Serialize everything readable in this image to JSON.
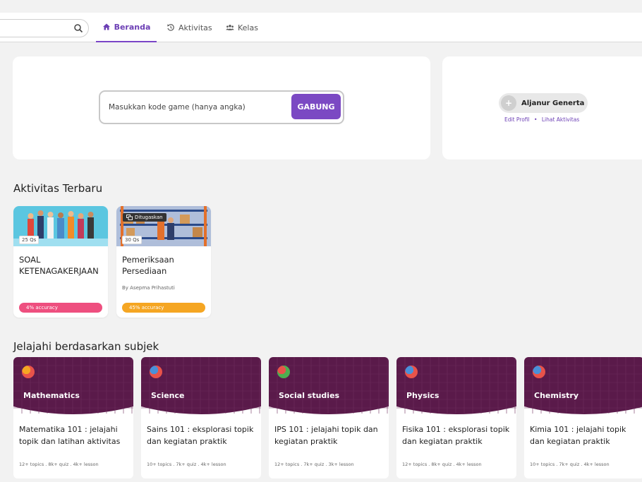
{
  "nav": {
    "tabs": [
      {
        "label": "Beranda",
        "icon": "home-icon"
      },
      {
        "label": "Aktivitas",
        "icon": "history-icon"
      },
      {
        "label": "Kelas",
        "icon": "users-icon"
      }
    ],
    "active_color": "#6c3fb5"
  },
  "join": {
    "placeholder": "Masukkan kode game (hanya angka)",
    "button_label": "GABUNG"
  },
  "profile": {
    "name": "Aljanur Generta",
    "edit_link": "Edit Profil",
    "separator": "•",
    "activity_link": "Lihat Aktivitas"
  },
  "recent": {
    "title": "Aktivitas Terbaru",
    "cards": [
      {
        "title": "SOAL KETENAGAKERJAAN",
        "questions": "25 Qs",
        "accuracy": "4% accuracy",
        "accuracy_color": "#ee4f7f",
        "tag": "",
        "author": ""
      },
      {
        "title": "Pemeriksaan Persediaan",
        "questions": "30 Qs",
        "accuracy": "45% accuracy",
        "accuracy_color": "#f5a623",
        "tag": "Ditugaskan",
        "author": "By Asepma Prihastuti"
      }
    ]
  },
  "explore": {
    "title": "Jelajahi berdasarkan subjek",
    "header_color": "#5a1a4a",
    "subjects": [
      {
        "name": "Mathematics",
        "desc": "Matematika 101 : jelajahi topik dan latihan aktivitas",
        "meta": "12+ topics . 8k+ quiz . 4k+ lesson"
      },
      {
        "name": "Science",
        "desc": "Sains 101 : eksplorasi topik dan kegiatan praktik",
        "meta": "10+ topics . 7k+ quiz . 4k+ lesson"
      },
      {
        "name": "Social studies",
        "desc": "IPS 101 : jelajahi topik dan kegiatan praktik",
        "meta": "12+ topics . 7k+ quiz . 3k+ lesson"
      },
      {
        "name": "Physics",
        "desc": "Fisika 101 : eksplorasi topik dan kegiatan praktik",
        "meta": "12+ topics . 8k+ quiz . 4k+ lesson"
      },
      {
        "name": "Chemistry",
        "desc": "Kimia 101 : jelajahi topik dan kegiatan praktik",
        "meta": "10+ topics . 7k+ quiz . 4k+ lesson"
      }
    ]
  }
}
